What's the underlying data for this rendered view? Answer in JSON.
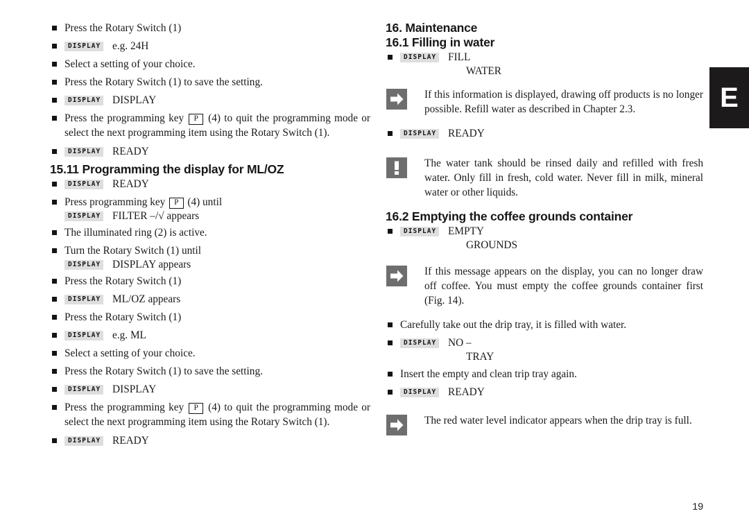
{
  "page": {
    "number": "19",
    "language_tab": "E"
  },
  "icons": {
    "display_badge": "DISPLAY",
    "bullet": "square-bullet",
    "arrow": "arrow-right-icon",
    "warning": "exclamation-icon",
    "p_key": "P"
  },
  "left_column": {
    "top_steps": [
      {
        "type": "text",
        "text": "Press the Rotary Switch (1)"
      },
      {
        "type": "display",
        "value": "e.g. 24H"
      },
      {
        "type": "text",
        "text": "Select a setting of your choice."
      },
      {
        "type": "text",
        "text": "Press the Rotary Switch (1) to save the setting."
      },
      {
        "type": "display",
        "value": "DISPLAY"
      }
    ],
    "quit_para": {
      "pre": "Press the programming key",
      "key": "P",
      "post": "(4) to quit the programming mode or select the next programming item using the Rotary Switch (1)."
    },
    "ready_after_quit": "READY",
    "heading_1511": "15.11 Programming the display for ML/OZ",
    "steps": [
      {
        "type": "display",
        "value": "READY"
      },
      {
        "type": "key_until",
        "pre": "Press programming key",
        "key": "P",
        "post": "(4) until",
        "display_value": "FILTER –/√ appears"
      },
      {
        "type": "text",
        "text": "The illuminated ring (2) is active."
      },
      {
        "type": "turn_until",
        "text": "Turn the Rotary Switch (1) until",
        "display_value": "DISPLAY appears"
      },
      {
        "type": "text",
        "text": "Press the Rotary Switch (1)"
      },
      {
        "type": "display",
        "value": "ML/OZ appears"
      },
      {
        "type": "text",
        "text": "Press the Rotary Switch (1)"
      },
      {
        "type": "display",
        "value": "e.g. ML"
      },
      {
        "type": "text",
        "text": "Select a setting of your choice."
      },
      {
        "type": "text",
        "text": "Press the Rotary Switch (1) to save the setting."
      },
      {
        "type": "display",
        "value": "DISPLAY"
      }
    ],
    "quit_para2": {
      "pre": "Press the programming key",
      "key": "P",
      "post": "(4) to quit the programming mode or select the next programming item using the Rotary Switch (1)."
    },
    "ready_final": "READY"
  },
  "right_column": {
    "heading_16": "16. Maintenance",
    "heading_161": "16.1 Filling in water",
    "display_fill_water": {
      "line1": "FILL",
      "line2": "WATER"
    },
    "note_fill": "If this information is displayed, drawing off products is no longer possible. Refill water as described in Chapter 2.3.",
    "display_ready_1": "READY",
    "note_tank": "The water tank should be rinsed daily and refilled with fresh water. Only fill in fresh, cold water. Never fill in milk, mineral water or other liquids.",
    "heading_162": "16.2 Emptying the coffee grounds container",
    "display_empty_grounds": {
      "line1": "EMPTY",
      "line2": "GROUNDS"
    },
    "note_grounds": "If this message appears on the display, you can no longer draw off coffee. You must empty the coffee grounds container first (Fig. 14).",
    "step_drip_tray": "Carefully take out the drip tray, it is filled with water.",
    "display_no_tray": {
      "line1": "NO –",
      "line2": "TRAY"
    },
    "step_insert_tray": "Insert the empty and clean trip tray again.",
    "display_ready_2": "READY",
    "note_indicator": "The red water level indicator appears when the drip tray is full."
  },
  "colors": {
    "badge_bg": "#dedede",
    "note_icon_bg": "#6e6e6e",
    "lang_tab_bg": "#1c1a1a",
    "text": "#1a1a1a"
  }
}
